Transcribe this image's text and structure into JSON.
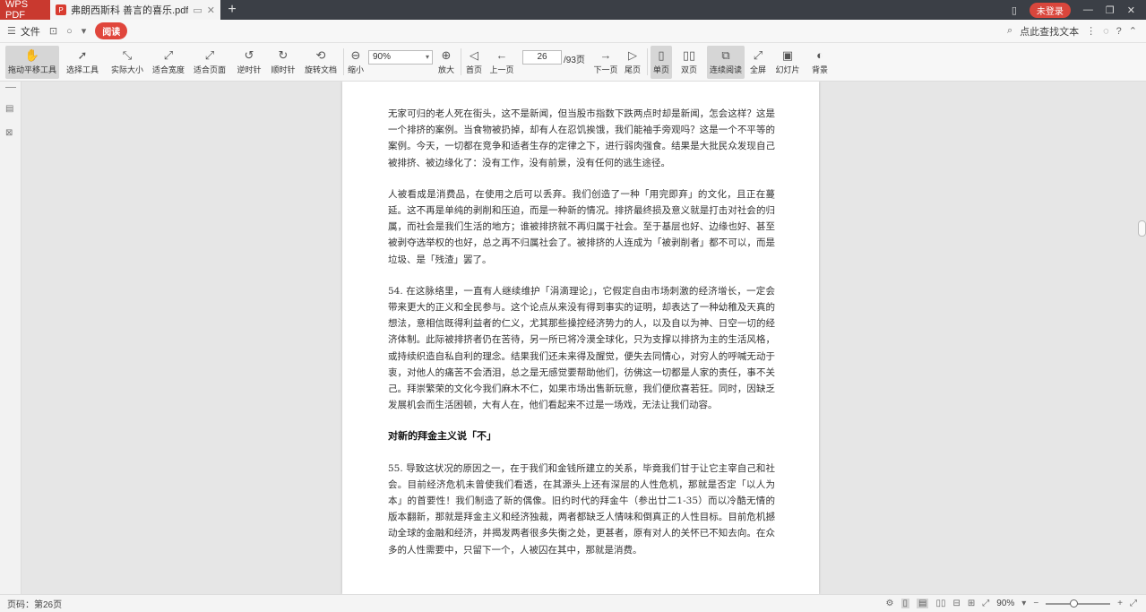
{
  "titlebar": {
    "app_name": "WPS PDF",
    "doc_tab": "弗朗西斯科 善言的喜乐.pdf",
    "login_label": "未登录"
  },
  "menubar": {
    "file_label": "文件",
    "read_label": "阅读",
    "search_label": "点此查找文本"
  },
  "toolbar": {
    "hand_tool": "拖动平移工具",
    "select_tool": "选择工具",
    "actual_size": "实际大小",
    "fit_width": "适合宽度",
    "fit_page": "适合页面",
    "rotate_left": "逆时针",
    "rotate_right": "顺时针",
    "rotate_doc": "旋转文档",
    "zoom_out": "缩小",
    "zoom_value": "90%",
    "zoom_in": "放大",
    "first_page": "首页",
    "prev_page": "上一页",
    "current_page": "26",
    "total_pages": "/93页",
    "next_page": "下一页",
    "last_page": "尾页",
    "single_page": "单页",
    "double_page": "双页",
    "continuous": "连续阅读",
    "fullscreen": "全屏",
    "slideshow": "幻灯片",
    "background": "背景"
  },
  "document": {
    "para1": "无家可归的老人死在街头，这不是新闻，但当股市指数下跌两点时却是新闻，怎会这样？这是一个排挤的案例。当食物被扔掉，却有人在忍饥挨饿，我们能袖手旁观吗？这是一个不平等的案例。今天，一切都在竞争和适者生存的定律之下，进行弱肉强食。结果是大批民众发现自己被排挤、被边缘化了：没有工作，没有前景，没有任何的逃生途径。",
    "para2": "人被看成是消费品，在使用之后可以丢弃。我们创造了一种「用完即弃」的文化，且正在蔓延。这不再是单纯的剥削和压迫，而是一种新的情况。排挤最终损及意义就是打击对社会的归属，而社会是我们生活的地方；谁被排挤就不再归属于社会。至于基层也好、边缘也好、甚至被剥夺选举权的也好，总之再不归属社会了。被排挤的人连成为「被剥削者」都不可以，而是垃圾、是「残渣」罢了。",
    "para3": "54. 在这脉络里，一直有人继续维护「涓滴理论」，它假定自由市场刺激的经济增长，一定会带来更大的正义和全民参与。这个论点从来没有得到事实的证明，却表达了一种幼稚及天真的想法，意相信既得利益者的仁义，尤其那些操控经济势力的人，以及自以为神、日空一切的经济体制。此际被排挤者仍在苦待，另一所已将冷漠全球化，只为支撑以排挤为主的生活风格，或持续织造自私自利的理念。结果我们还未来得及醒觉，便失去同情心，对穷人的呼喊无动于衷，对他人的痛苦不会洒泪，总之是无感觉要帮助他们，彷佛这一切都是人家的责任，事不关己。拜崇繁荣的文化今我们麻木不仁，如果市场出售新玩意，我们便欣喜若狂。同时，因缺乏发展机会而生活困顿，大有人在，他们看起来不过是一场戏，无法让我们动容。",
    "heading": "对新的拜金主义说「不」",
    "para4": "55. 导致这状况的原因之一，在于我们和金钱所建立的关系，毕竟我们甘于让它主宰自己和社会。目前经济危机未曾使我们看透，在其源头上还有深层的人性危机，那就是否定「以人为本」的首要性！我们制造了新的偶像。旧约时代的拜金牛（参出廿二1-35）而以冷酷无情的版本翻新，那就是拜金主义和经济独裁，两者都缺乏人情味和倒真正的人性目标。目前危机撼动全球的金融和经济，并揭发两者很多失衡之处，更甚者，原有对人的关怀已不知去向。在众多的人性需要中，只留下一个，人被囚在其中，那就是消费。"
  },
  "statusbar": {
    "page_info": "页码：第26页",
    "zoom_value": "90%"
  }
}
